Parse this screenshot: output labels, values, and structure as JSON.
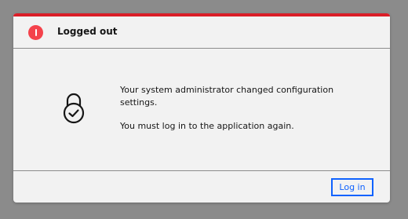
{
  "dialog": {
    "title": "Logged out",
    "status_icon": "error-icon",
    "illustration_icon": "lock-check-icon",
    "message_line1": "Your system administrator changed configuration settings.",
    "message_line2": "You must log in to the application again.",
    "primary_button_label": "Log in"
  },
  "colors": {
    "overlay": "#8b8b8b",
    "dialog_background": "#f2f2f2",
    "error_accent": "#da1e28",
    "error_icon": "#f4424b",
    "primary": "#0f62fe",
    "text": "#161616"
  }
}
